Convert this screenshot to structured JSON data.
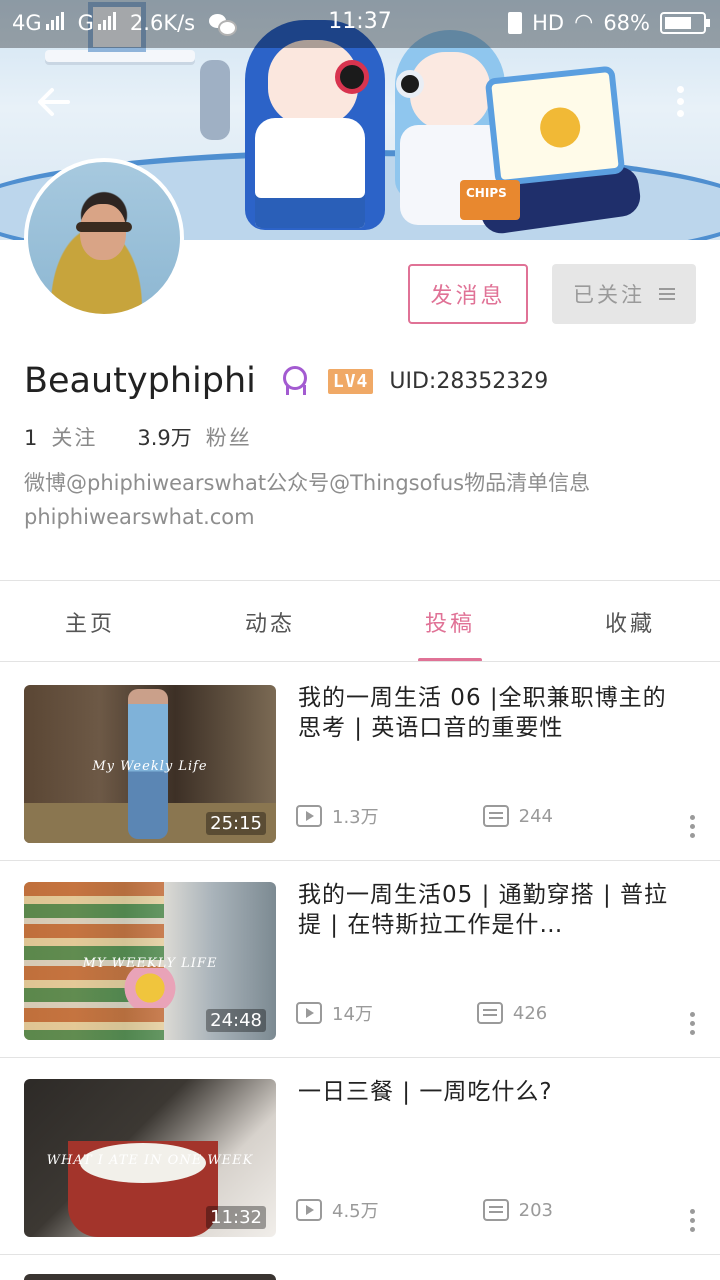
{
  "status_bar": {
    "network1": "4G",
    "network2": "G",
    "speed": "2.6K/s",
    "time": "11:37",
    "hd": "HD",
    "battery": "68%"
  },
  "profile": {
    "username": "Beautyphiphi",
    "level": "LV4",
    "uid": "UID:28352329",
    "following_count": "1",
    "following_label": "关注",
    "followers_count": "3.9万",
    "followers_label": "粉丝",
    "bio_line1": "微博@phiphiwearswhat公众号@Thingsofus物品清单信息",
    "bio_line2": "phiphiwearswhat.com"
  },
  "actions": {
    "message_label": "发消息",
    "follow_label": "已关注"
  },
  "tabs": [
    {
      "label": "主页",
      "active": false
    },
    {
      "label": "动态",
      "active": false
    },
    {
      "label": "投稿",
      "active": true
    },
    {
      "label": "收藏",
      "active": false
    }
  ],
  "banner": {
    "chips_text": "CHIPS"
  },
  "videos": [
    {
      "title": "我的一周生活 06 |全职兼职博主的思考 | 英语口音的重要性",
      "thumb_text": "My Weekly Life",
      "duration": "25:15",
      "views": "1.3万",
      "comments": "244"
    },
    {
      "title": "我的一周生活05 | 通勤穿搭 | 普拉提 | 在特斯拉工作是什…",
      "thumb_text": "MY WEEKLY LIFE",
      "duration": "24:48",
      "views": "14万",
      "comments": "426"
    },
    {
      "title": "一日三餐 | 一周吃什么?",
      "thumb_text": "WHAT I ATE IN ONE WEEK",
      "duration": "11:32",
      "views": "4.5万",
      "comments": "203"
    }
  ],
  "colors": {
    "accent": "#e07296",
    "level_badge": "#f0a966",
    "medal": "#a35bd1"
  }
}
